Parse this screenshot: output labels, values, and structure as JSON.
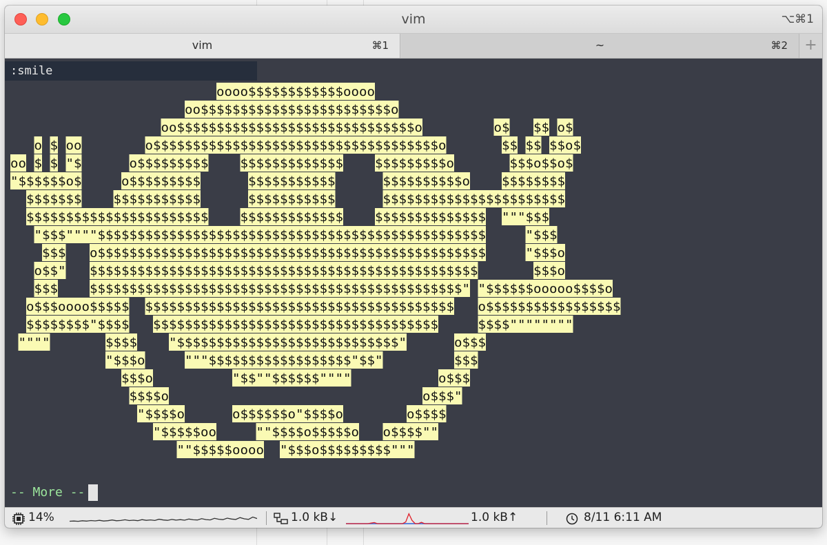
{
  "window": {
    "title": "vim",
    "shortcut": "⌥⌘1"
  },
  "tabs": [
    {
      "label": "vim",
      "key": "⌘1",
      "active": true
    },
    {
      "label": "~",
      "key": "⌘2",
      "active": false
    }
  ],
  "new_tab_label": "+",
  "terminal": {
    "command": ":smile",
    "more_prompt": "-- More --",
    "art_color": "#fafab4",
    "background_color": "#3a3d47",
    "art": [
      "                          oooo$$$$$$$$$$$$oooo",
      "                      oo$$$$$$$$$$$$$$$$$$$$$$$$o",
      "                   oo$$$$$$$$$$$$$$$$$$$$$$$$$$$$$$o         o$   $$ o$",
      "   o $ oo        o$$$$$$$$$$$$$$$$$$$$$$$$$$$$$$$$$$$$o       $$ $$ $$o$",
      "oo $ $ \"$      o$$$$$$$$$    $$$$$$$$$$$$$    $$$$$$$$$o       $$$o$$o$",
      "\"$$$$$$o$     o$$$$$$$$$      $$$$$$$$$$$      $$$$$$$$$$o    $$$$$$$$",
      "  $$$$$$$    $$$$$$$$$$$      $$$$$$$$$$$      $$$$$$$$$$$$$$$$$$$$$$$",
      "  $$$$$$$$$$$$$$$$$$$$$$$    $$$$$$$$$$$$$    $$$$$$$$$$$$$$  \"\"\"$$$",
      "   \"$$$\"\"\"\"$$$$$$$$$$$$$$$$$$$$$$$$$$$$$$$$$$$$$$$$$$$$$$$$$     \"$$$",
      "    $$$   o$$$$$$$$$$$$$$$$$$$$$$$$$$$$$$$$$$$$$$$$$$$$$$$$$     \"$$$o",
      "   o$$\"   $$$$$$$$$$$$$$$$$$$$$$$$$$$$$$$$$$$$$$$$$$$$$$$$$       $$$o",
      "   $$$    $$$$$$$$$$$$$$$$$$$$$$$$$$$$$$$$$$$$$$$$$$$$$$$\" \"$$$$$$ooooo$$$$o",
      "  o$$$oooo$$$$$  $$$$$$$$$$$$$$$$$$$$$$$$$$$$$$$$$$$$$$$   o$$$$$$$$$$$$$$$$$",
      "  $$$$$$$$\"$$$$   $$$$$$$$$$$$$$$$$$$$$$$$$$$$$$$$$$$$     $$$$\"\"\"\"\"\"\"\"",
      " \"\"\"\"       $$$$    \"$$$$$$$$$$$$$$$$$$$$$$$$$$$$\"      o$$$",
      "            \"$$$o     \"\"\"$$$$$$$$$$$$$$$$$$\"$$\"         $$$",
      "              $$$o          \"$$\"\"$$$$$$\"\"\"\"           o$$$",
      "               $$$$o                                o$$$\"",
      "                \"$$$$o      o$$$$$$o\"$$$$o        o$$$$",
      "                  \"$$$$$oo     \"\"$$$$o$$$$$o   o$$$$\"\"",
      "                     \"\"$$$$$oooo  \"$$$o$$$$$$$$$\"\"\""
    ]
  },
  "status": {
    "cpu_icon": "cpu-chip-icon",
    "cpu": "14%",
    "net_icon": "network-icon",
    "down": "1.0 kB↓",
    "up": "1.0 kB↑",
    "clock_icon": "clock-icon",
    "datetime": "8/11 6:11 AM",
    "cpu_history": [
      0.22,
      0.24,
      0.21,
      0.26,
      0.23,
      0.28,
      0.25,
      0.3,
      0.24,
      0.27,
      0.33,
      0.26,
      0.29,
      0.35,
      0.28,
      0.31,
      0.27,
      0.36,
      0.3,
      0.34,
      0.29,
      0.4,
      0.33,
      0.3,
      0.38,
      0.32,
      0.36,
      0.31,
      0.42,
      0.35,
      0.33,
      0.45,
      0.37,
      0.34,
      0.48,
      0.4,
      0.36,
      0.5,
      0.42,
      0.38,
      0.55,
      0.44,
      0.39,
      0.6,
      0.46
    ],
    "net_history": [
      0,
      0,
      0,
      0,
      0,
      0,
      0,
      0,
      0.05,
      0.1,
      0,
      0,
      0,
      0,
      0,
      0,
      0,
      0,
      0,
      0.15,
      0.9,
      0.3,
      0,
      0,
      0.12,
      0,
      0,
      0,
      0,
      0,
      0,
      0,
      0,
      0,
      0,
      0,
      0,
      0,
      0,
      0
    ]
  }
}
